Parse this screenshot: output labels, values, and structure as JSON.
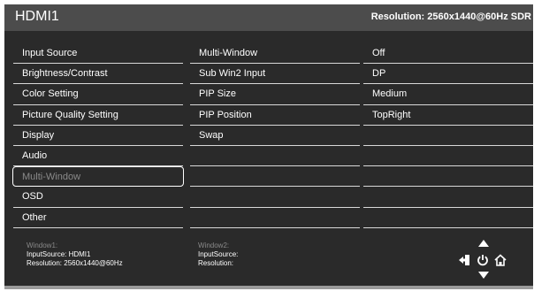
{
  "header": {
    "title": "HDMI1",
    "resolution": "Resolution: 2560x1440@60Hz SDR"
  },
  "menu": {
    "items": [
      {
        "label": "Input Source"
      },
      {
        "label": "Brightness/Contrast"
      },
      {
        "label": "Color Setting"
      },
      {
        "label": "Picture Quality Setting"
      },
      {
        "label": "Display"
      },
      {
        "label": "Audio"
      },
      {
        "label": "Multi-Window"
      },
      {
        "label": "OSD"
      },
      {
        "label": "Other"
      }
    ],
    "selected_index": 6
  },
  "submenu": {
    "items": [
      {
        "label": "Multi-Window"
      },
      {
        "label": "Sub Win2 Input"
      },
      {
        "label": "PIP Size"
      },
      {
        "label": "PIP Position"
      },
      {
        "label": "Swap"
      },
      {
        "label": ""
      },
      {
        "label": ""
      },
      {
        "label": ""
      },
      {
        "label": ""
      }
    ]
  },
  "values": {
    "items": [
      {
        "label": "Off"
      },
      {
        "label": "DP"
      },
      {
        "label": "Medium"
      },
      {
        "label": "TopRight"
      },
      {
        "label": ""
      },
      {
        "label": ""
      },
      {
        "label": ""
      },
      {
        "label": ""
      },
      {
        "label": ""
      }
    ]
  },
  "window1": {
    "title": "Window1:",
    "input_source": "InputSource: HDMI1",
    "resolution": "Resolution: 2560x1440@60Hz"
  },
  "window2": {
    "title": "Window2:",
    "input_source": "InputSource:",
    "resolution": "Resolution:"
  },
  "keys": {
    "icons": [
      "up-arrow-icon",
      "exit-icon",
      "power-icon",
      "home-icon",
      "down-arrow-icon"
    ]
  },
  "colors": {
    "background": "#2a2a2a",
    "header": "#4c4c4c",
    "text": "#ffffff",
    "dim_text": "#8a8a8a"
  }
}
